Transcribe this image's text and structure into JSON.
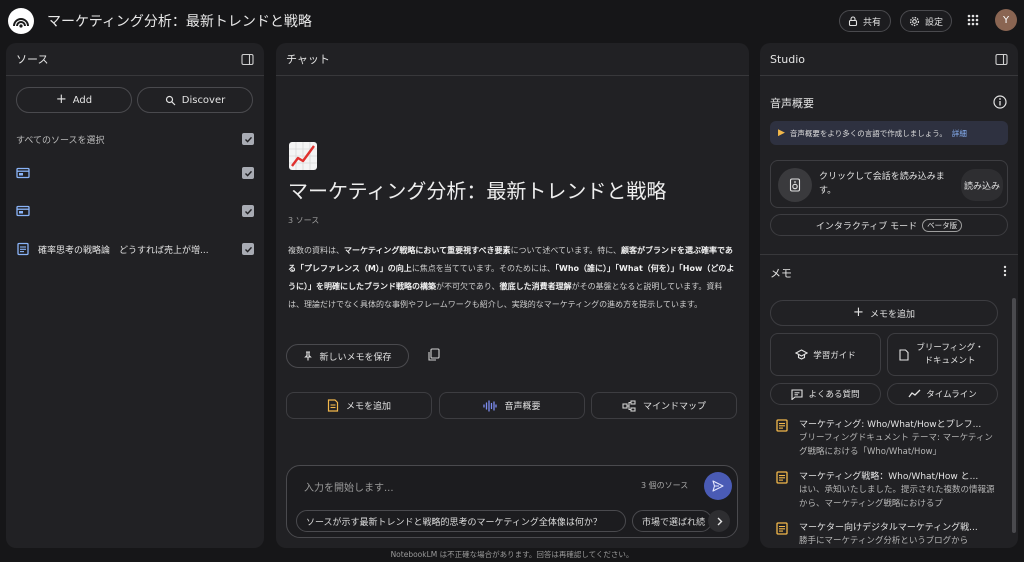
{
  "app": {
    "title": "マーケティング分析：最新トレンドと戦略",
    "share_label": "共有",
    "settings_label": "設定",
    "avatar_initial": "Y",
    "footer": "NotebookLM は不正確な場合があります。回答は再確認してください。"
  },
  "sources": {
    "header": "ソース",
    "add_label": "Add",
    "discover_label": "Discover",
    "select_all_label": "すべてのソースを選択",
    "items": [
      {
        "icon": "web-icon",
        "label": ""
      },
      {
        "icon": "web-icon",
        "label": ""
      },
      {
        "icon": "doc-icon",
        "label": "確率思考の戦略論　どうすれば売上が増..."
      }
    ]
  },
  "chat": {
    "header": "チャット",
    "emoji": "chart-increasing-icon",
    "title": "マーケティング分析：最新トレンドと戦略",
    "source_count": "3 ソース",
    "summary_parts": [
      {
        "text": "複数の資料は、",
        "bold": false
      },
      {
        "text": "マーケティング戦略において重要視すべき要素",
        "bold": true
      },
      {
        "text": "について述べています。特に、",
        "bold": false
      },
      {
        "text": "顧客がブランドを選ぶ確率である「プレファレンス（M）」の向上",
        "bold": true
      },
      {
        "text": "に焦点を当てています。そのためには、",
        "bold": false
      },
      {
        "text": "「Who（誰に）」「What（何を）」「How（どのように）」を明確にしたブランド戦略の構築",
        "bold": true
      },
      {
        "text": "が不可欠であり、",
        "bold": false
      },
      {
        "text": "徹底した消費者理解",
        "bold": true
      },
      {
        "text": "がその基盤となると説明しています。資料は、理論だけでなく具体的な事例やフレームワークも紹介し、実践的なマーケティングの進め方を提示しています。",
        "bold": false
      }
    ],
    "save_note_label": "新しいメモを保存",
    "actions": {
      "add_note": "メモを追加",
      "audio": "音声概要",
      "mindmap": "マインドマップ"
    },
    "input_placeholder": "入力を開始します...",
    "input_source_count": "3 個のソース",
    "suggestions": [
      "ソースが示す最新トレンドと戦略的思考のマーケティング全体像は何か？",
      "市場で選ばれ続"
    ]
  },
  "studio": {
    "header": "Studio",
    "audio_title": "音声概要",
    "banner_text": "音声概要をより多くの言語で作成しましょう。",
    "banner_link": "詳細",
    "audio_card_text": "クリックして会話を読み込みます。",
    "load_label": "読み込み",
    "interactive_label": "インタラクティブ モード",
    "beta_label": "ベータ版",
    "memo_title": "メモ",
    "add_memo_label": "メモを追加",
    "chips": {
      "study": "学習ガイド",
      "brief": "ブリーフィング・ドキュメント",
      "faq": "よくある質問",
      "timeline": "タイムライン"
    },
    "notes": [
      {
        "title": "マーケティング: Who/What/Howとプレフ...",
        "preview": "ブリーフィングドキュメント テーマ: マーケティング戦略における「Who/What/How」"
      },
      {
        "title": "マーケティング戦略：Who/What/How と...",
        "preview": "はい、承知いたしました。提示された複数の情報源から、マーケティング戦略におけるプ"
      },
      {
        "title": "マーケター向けデジタルマーケティング戦...",
        "preview": "勝手にマーケティング分析というブログから"
      }
    ]
  },
  "colors": {
    "background": "#161618",
    "panel": "#212124",
    "accent": "#4a5bb5",
    "note_icon": "#f2b84b",
    "link": "#8ab4f8"
  }
}
